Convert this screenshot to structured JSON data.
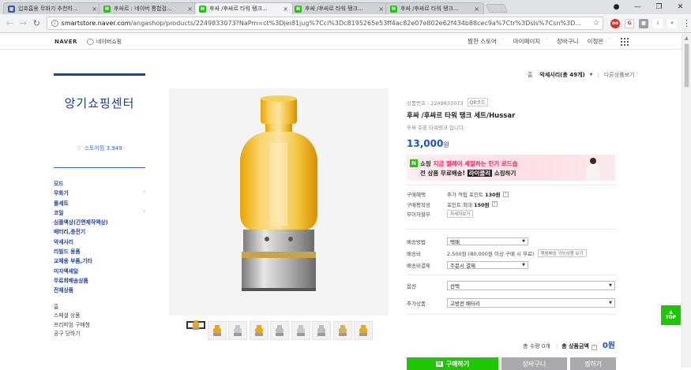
{
  "browser": {
    "tabs": [
      {
        "title": "입호흡용 무화기 추천하...",
        "icon": "blog-icon",
        "color": "#3b5998",
        "active": false
      },
      {
        "title": "후싸르 : 네이버 통합검...",
        "icon": "naver-icon",
        "color": "#1ec800",
        "active": false
      },
      {
        "title": "후싸 /후싸르 타워 탱크...",
        "icon": "naver-shop-icon",
        "color": "#1ec800",
        "active": true
      },
      {
        "title": "후싸 /후싸르 타워 탱크...",
        "icon": "naver-shop-icon",
        "color": "#1ec800",
        "active": false
      },
      {
        "title": "후싸 /후싸르 타워 탱크...",
        "icon": "naver-shop-icon",
        "color": "#1ec800",
        "active": false
      }
    ],
    "url_host": "smartstore.naver.com",
    "url_path": "/angashop/products/2249833073?NaPm=ct%3Djei81jug%7Cci%3Dc8195265e53ff4ac82e07e802e62f434b88cec9a%7Ctr%3Dsls%7Csn%3D..."
  },
  "naver": {
    "logo": "NAVER",
    "shop": "네이버쇼핑",
    "nav": [
      "찜한 스토어",
      "마이페이지",
      "장바구니",
      "이정은"
    ]
  },
  "breadcrumb": {
    "home": "홈",
    "current": "악세사리(총 49개)",
    "other": "다른상품보기"
  },
  "sidebar": {
    "store_name": "앙기쇼핑센터",
    "follow_label": "스토어찜",
    "follow_count": "3,949",
    "categories": [
      {
        "label": "모드",
        "arrow": false
      },
      {
        "label": "무화기",
        "arrow": true
      },
      {
        "label": "풀세트",
        "arrow": false
      },
      {
        "label": "코일",
        "arrow": true
      },
      {
        "label": "심플액상(간편제작액상)",
        "arrow": false
      },
      {
        "label": "배터리,충전기",
        "arrow": false
      },
      {
        "label": "악세사리",
        "arrow": false
      },
      {
        "label": "리빌드 용품",
        "arrow": false
      },
      {
        "label": "교체용 부품,기타",
        "arrow": false
      },
      {
        "label": "미자액세일",
        "arrow": false
      },
      {
        "label": "무료회배송상품",
        "arrow": false
      },
      {
        "label": "전체상품",
        "arrow": false
      }
    ],
    "subcategories": [
      "홈",
      "스페셜 상품",
      "프리미엄 구매형",
      "공구 당하기"
    ]
  },
  "product": {
    "code_label": "상품번호 : 2249833073",
    "qr_label": "QR코드",
    "name": "후싸 /후싸르 타워 탱크 세트/Hussar",
    "desc": "후싸 호환 타워탱크 입니다.",
    "price": "13,000",
    "price_unit": "원"
  },
  "banner": {
    "line1_prefix": "쇼핑",
    "line1_highlight": "지금 릴레이 세일하는 인기 로드숍",
    "line2_prefix": "전 상품 무료배송!",
    "line2_tag": "라이클리",
    "line2_suffix": "쇼핑하기"
  },
  "rows": {
    "benefit_label": "구매혜택",
    "benefit_value_prefix": "추가 적립 포인트",
    "benefit_value_bold": "130원",
    "review_label": "구매평작성",
    "review_value_prefix": "포인트 최대",
    "review_value_bold": "150원",
    "installment_label": "무이자할부",
    "installment_btn": "자세히보기",
    "ship_method_label": "배송방법",
    "ship_method_value": "택배",
    "ship_fee_label": "배송비",
    "ship_fee_value": "2,500원 (80,000원 이상 구매 시 무료)",
    "ship_fee_btn": "묶음배송 가능상품 보기",
    "ship_pay_label": "배송비결제",
    "ship_pay_value": "주문시 결제"
  },
  "options": {
    "option_label": "옵션",
    "option_value": "선택",
    "addon_label": "추가상품",
    "addon_value": "고방전 배터리"
  },
  "total": {
    "count": "총 수량 0개",
    "amount_label": "총 상품금액",
    "amount": "0원"
  },
  "actions": {
    "buy": "구매하기",
    "cart": "장바구니",
    "wish": "찜하기",
    "top": "TOP"
  }
}
